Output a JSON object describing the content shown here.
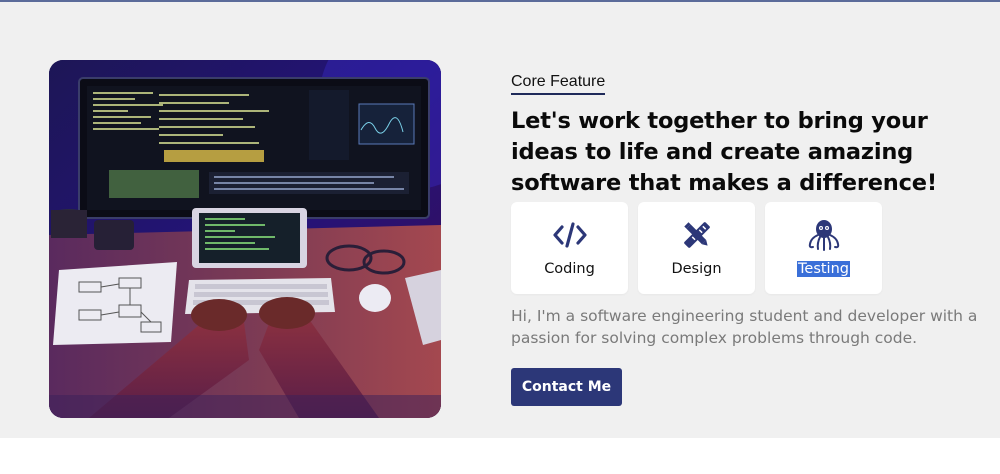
{
  "feature": {
    "eyebrow": "Core Feature",
    "headline": "Let's work together to bring your ideas to life and create amazing software that makes a difference!",
    "cards": [
      {
        "label": "Coding",
        "icon": "code-icon"
      },
      {
        "label": "Design",
        "icon": "design-tools-icon"
      },
      {
        "label": "Testing",
        "icon": "octopus-icon"
      }
    ],
    "description": "Hi, I'm a software engineering student and developer with a passion for solving complex problems through code.",
    "button_label": "Contact Me"
  },
  "colors": {
    "accent": "#2c3778",
    "icon": "#2c3778",
    "section_bg": "#f0f0f0",
    "selection": "#3a6fd8"
  }
}
